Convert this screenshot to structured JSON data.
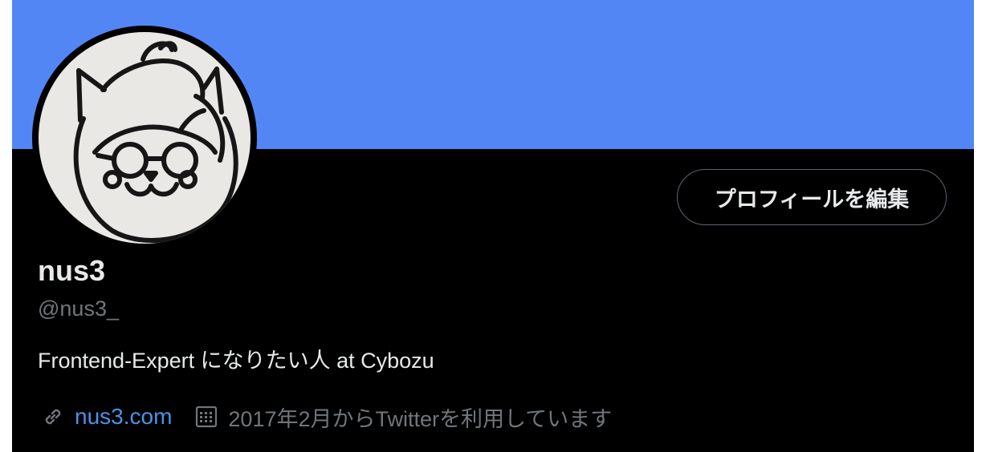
{
  "profile": {
    "display_name": "nus3",
    "handle": "@nus3_",
    "bio": "Frontend-Expert になりたい人 at Cybozu",
    "website": "nus3.com",
    "joined": "2017年2月からTwitterを利用しています",
    "edit_button_label": "プロフィールを編集"
  },
  "icons": {
    "website": "link-icon",
    "joined": "calendar-icon"
  },
  "colors": {
    "banner": "#5386f5",
    "background": "#000000",
    "primary_text": "#e7e9ea",
    "secondary_text": "#71767b",
    "link": "#4a93e8"
  }
}
